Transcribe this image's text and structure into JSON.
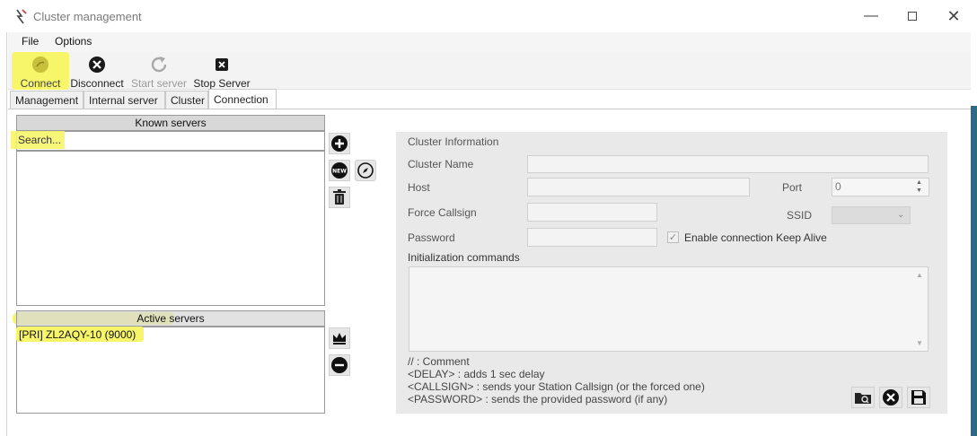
{
  "window": {
    "title": "Cluster management"
  },
  "menu": {
    "file": "File",
    "options": "Options"
  },
  "toolbar": {
    "connect": "Connect",
    "disconnect": "Disconnect",
    "start_server": "Start server",
    "stop_server": "Stop Server"
  },
  "tabs": [
    "Management",
    "Internal server",
    "Cluster",
    "Connection"
  ],
  "known_servers": {
    "header": "Known servers",
    "search_placeholder": "Search..."
  },
  "active_servers": {
    "header": "Active servers",
    "items": [
      "[PRI] ZL2AQY-10 (9000)"
    ]
  },
  "cluster_info": {
    "title": "Cluster Information",
    "cluster_name_label": "Cluster Name",
    "host_label": "Host",
    "port_label": "Port",
    "port_value": "0",
    "force_callsign_label": "Force Callsign",
    "ssid_label": "SSID",
    "password_label": "Password",
    "keep_alive_label": "Enable connection Keep Alive",
    "keep_alive_checked": true,
    "init_commands_label": "Initialization commands",
    "hints": [
      "// : Comment",
      "<DELAY> : adds 1 sec delay",
      "<CALLSIGN> : sends your Station Callsign (or the forced one)",
      "<PASSWORD> : sends the provided password (if any)"
    ]
  },
  "colors": {
    "highlight": "#f7f56a",
    "panel": "#e9e9e9",
    "header": "#d8d8d8"
  }
}
